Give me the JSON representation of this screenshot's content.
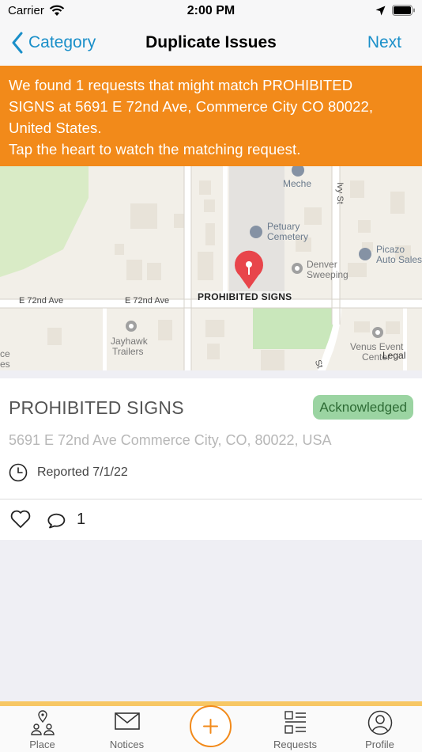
{
  "status": {
    "carrier": "Carrier",
    "time": "2:00 PM"
  },
  "nav": {
    "back_label": "Category",
    "title": "Duplicate Issues",
    "next_label": "Next"
  },
  "banner": {
    "line1": "We found 1 requests that might match PROHIBITED",
    "line2": "SIGNS at 5691 E 72nd Ave, Commerce City CO 80022,",
    "line3": "United States.",
    "line4": "Tap the heart to watch the matching request."
  },
  "map": {
    "pin_label": "PROHIBITED SIGNS",
    "street_left": "E 72nd Ave",
    "street_mid": "E 72nd Ave",
    "street_ivy_north": "Ivy St",
    "street_ivy_south": "St",
    "poi_meche": "Meche",
    "poi_cemetery_1": "Petuary",
    "poi_cemetery_2": "Cemetery",
    "poi_denver_1": "Denver",
    "poi_denver_2": "Sweeping",
    "poi_picazo_1": "Picazo",
    "poi_picazo_2": "Auto Sales",
    "poi_jayhawk_1": "Jayhawk",
    "poi_jayhawk_2": "Trailers",
    "poi_venus_1": "Venus Event",
    "poi_venus_2": "Center",
    "poi_edge_1": "ce",
    "poi_edge_2": "es",
    "legal": "Legal"
  },
  "request": {
    "title": "PROHIBITED SIGNS",
    "status": "Acknowledged",
    "address": "5691 E 72nd Ave Commerce City, CO, 80022, USA",
    "reported": "Reported 7/1/22",
    "comment_count": "1"
  },
  "tabs": [
    {
      "label": "Place",
      "icon": "place-icon"
    },
    {
      "label": "Notices",
      "icon": "mail-icon"
    },
    {
      "label": "",
      "icon": "add-icon"
    },
    {
      "label": "Requests",
      "icon": "list-icon"
    },
    {
      "label": "Profile",
      "icon": "profile-icon"
    }
  ],
  "colors": {
    "accent_orange": "#f28a1a",
    "link_blue": "#1a8fc9",
    "badge_green": "#9bd4a2",
    "pin_red": "#e8454b",
    "tab_accent": "#f7c764"
  }
}
